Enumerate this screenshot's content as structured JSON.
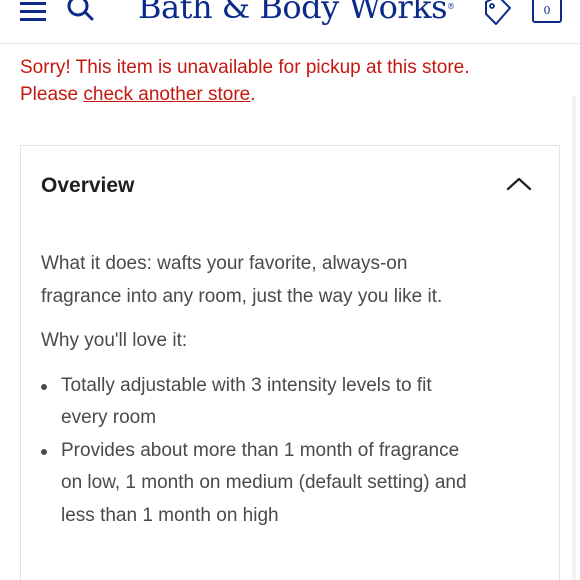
{
  "header": {
    "brand": "Bath & Body Works",
    "brand_mark": "®",
    "bag_count": "0"
  },
  "alert": {
    "line1": "Sorry! This item is unavailable for pickup at this store.",
    "prefix": "Please ",
    "link": "check another store",
    "suffix": "."
  },
  "overview": {
    "title": "Overview",
    "what_it_does": "What it does: wafts your favorite, always-on fragrance into any room, just the way you like it.",
    "why_love": "Why you'll love it:",
    "bullets": [
      "Totally adjustable with 3 intensity levels to fit every room",
      "Provides about more than 1 month of fragrance on low, 1 month on medium (default setting) and less than 1 month on high"
    ]
  },
  "colors": {
    "brand": "#0b2a8a",
    "alert": "#c4170e",
    "text": "#4a4a4a"
  },
  "icons": [
    "menu-icon",
    "search-icon",
    "tag-icon",
    "bag-icon",
    "chevron-up-icon"
  ]
}
